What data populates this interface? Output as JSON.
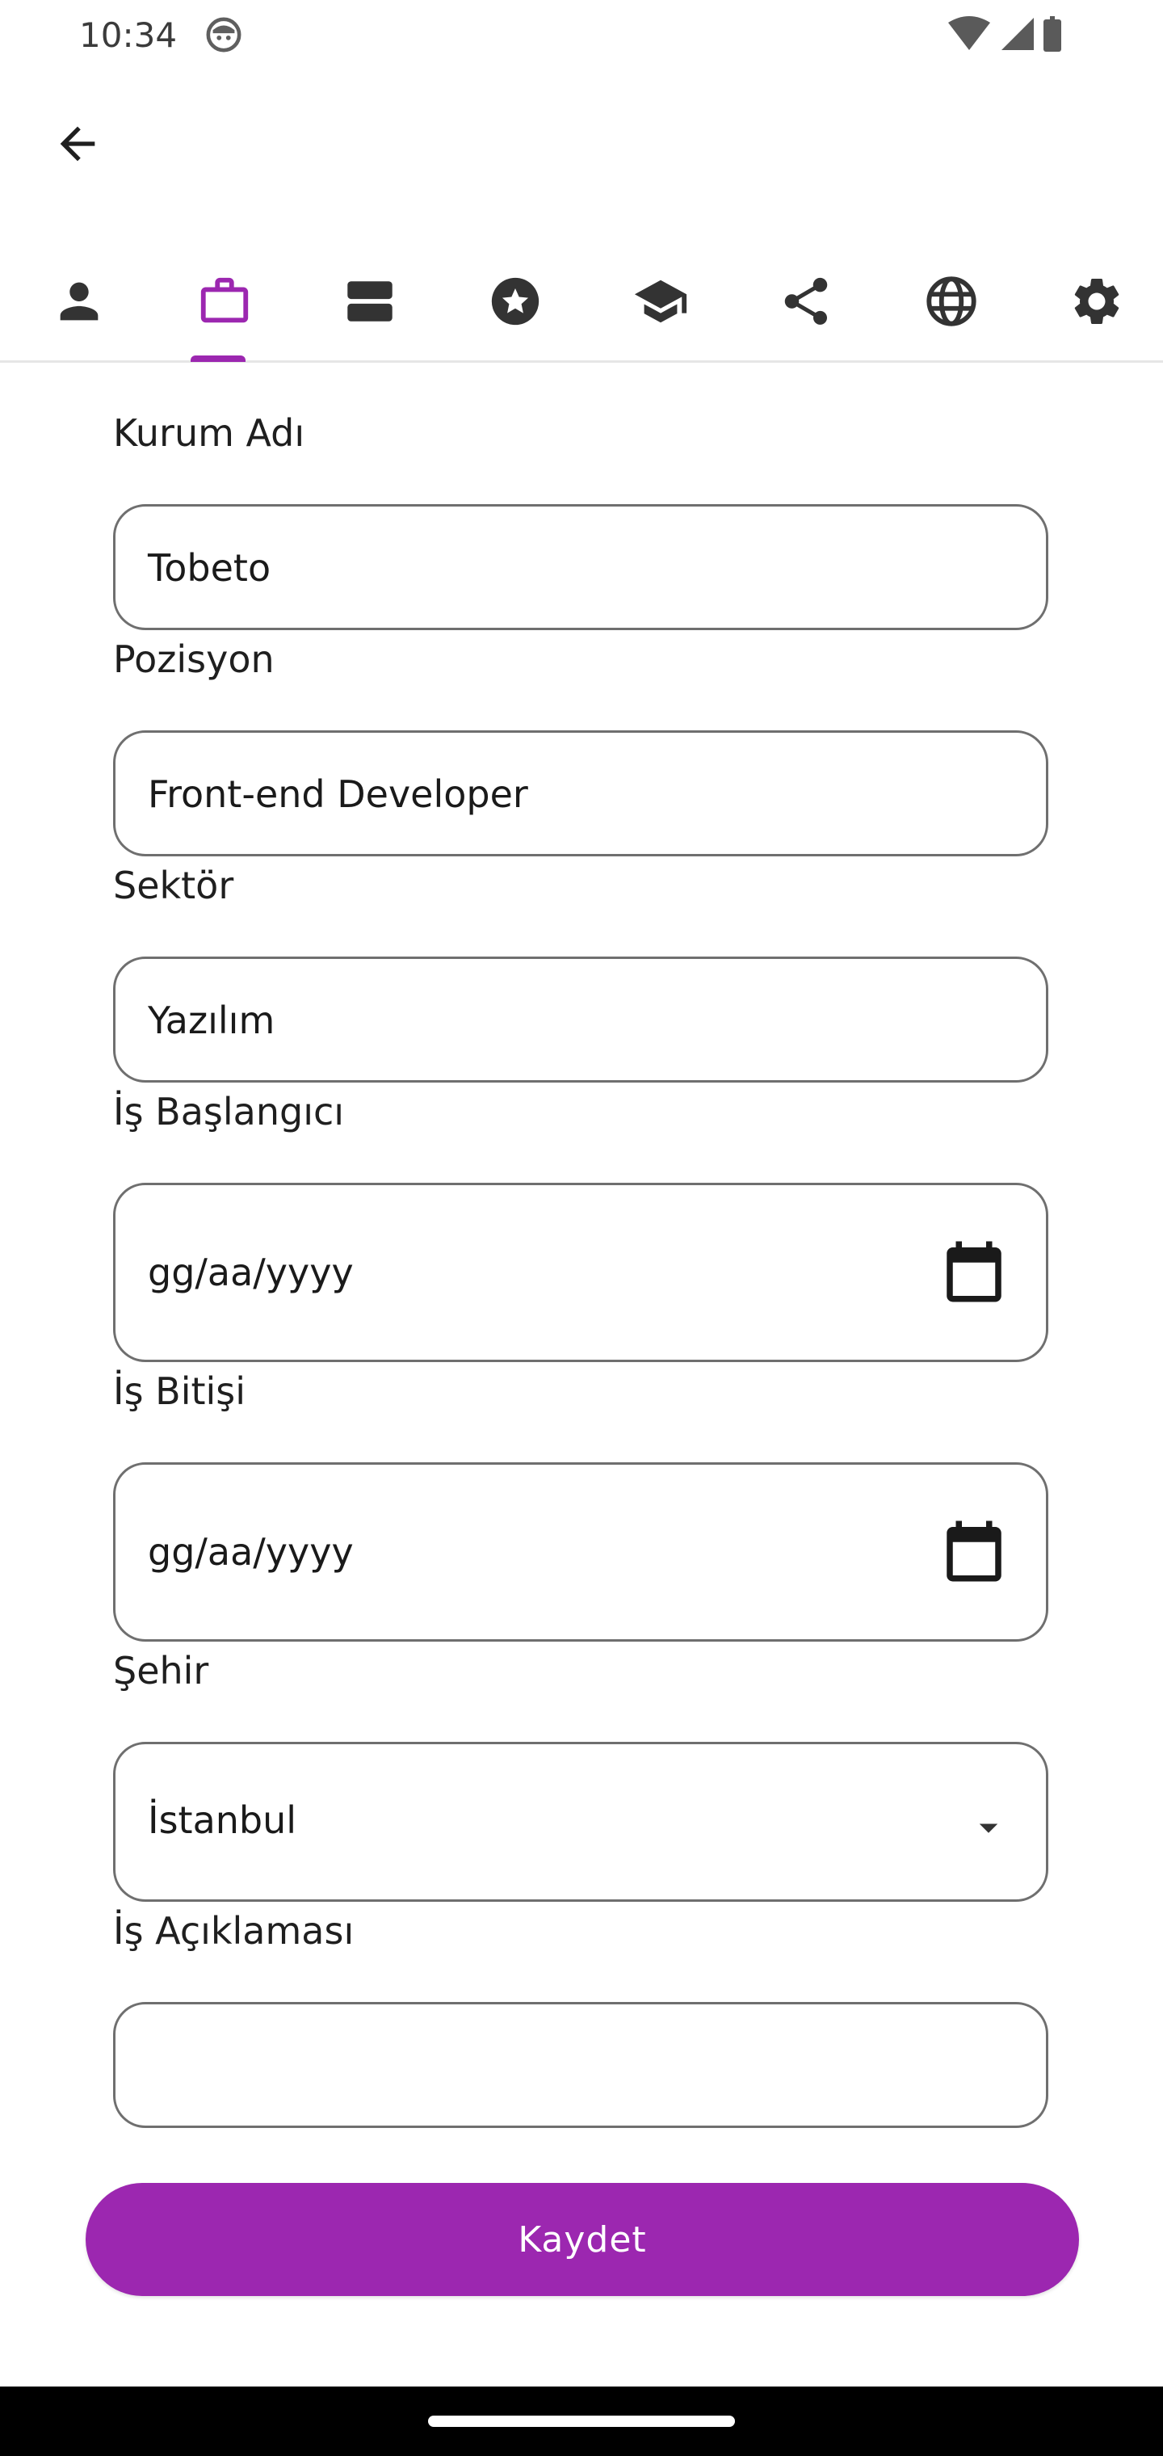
{
  "status_bar": {
    "time": "10:34",
    "icons": [
      "face-icon",
      "wifi-icon",
      "signal-icon",
      "battery-icon"
    ]
  },
  "app_bar": {
    "back_icon": "arrow-back-icon"
  },
  "tabs": {
    "selected_index": 1,
    "accent_color": "#9c27b0",
    "items": [
      {
        "icon": "person-icon"
      },
      {
        "icon": "briefcase-icon"
      },
      {
        "icon": "storage-icon"
      },
      {
        "icon": "star-badge-icon"
      },
      {
        "icon": "school-icon"
      },
      {
        "icon": "share-icon"
      },
      {
        "icon": "globe-icon"
      },
      {
        "icon": "gear-icon"
      }
    ]
  },
  "form": {
    "company": {
      "label": "Kurum Adı",
      "value": "Tobeto"
    },
    "position": {
      "label": "Pozisyon",
      "value": "Front-end Developer"
    },
    "sector": {
      "label": "Sektör",
      "value": "Yazılım"
    },
    "start_date": {
      "label": "İş Başlangıcı",
      "placeholder": "gg/aa/yyyy"
    },
    "end_date": {
      "label": "İş Bitişi",
      "placeholder": "gg/aa/yyyy"
    },
    "city": {
      "label": "Şehir",
      "value": "İstanbul"
    },
    "description": {
      "label": "İş Açıklaması",
      "value": ""
    }
  },
  "save_button": {
    "label": "Kaydet",
    "color": "#9c27b0"
  }
}
